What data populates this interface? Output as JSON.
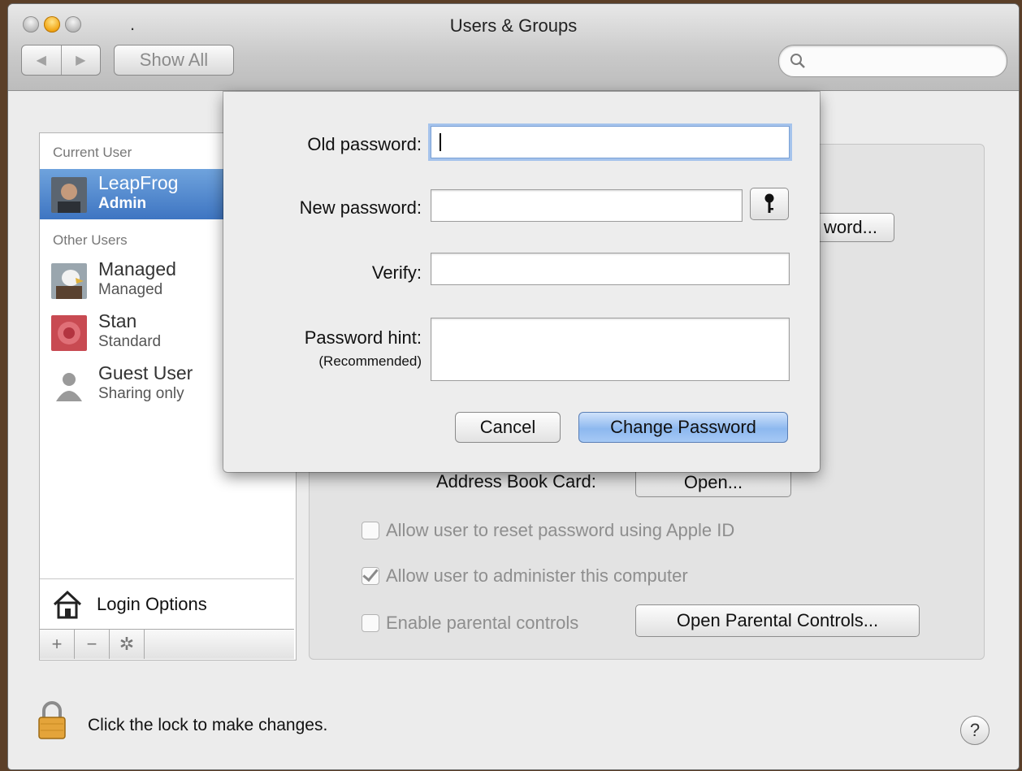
{
  "window": {
    "title": "Users & Groups",
    "title_dot": "."
  },
  "toolbar": {
    "back": "◀",
    "forward": "▶",
    "show_all": "Show All",
    "search_placeholder": ""
  },
  "sidebar": {
    "current_header": "Current User",
    "other_header": "Other Users",
    "users": [
      {
        "name": "LeapFrog",
        "role": "Admin",
        "selected": true
      },
      {
        "name": "Managed",
        "role": "Managed"
      },
      {
        "name": "Stan",
        "role": "Standard"
      },
      {
        "name": "Guest User",
        "role": "Sharing only"
      }
    ],
    "login_options": "Login Options",
    "add": "+",
    "remove": "−",
    "action": "✲"
  },
  "panel": {
    "change_password_button": "word...",
    "address_book_label": "Address Book Card:",
    "open_button": "Open...",
    "reset_apple_id": "Allow user to reset password using Apple ID",
    "administer": "Allow user to administer this computer",
    "parental": "Enable parental controls",
    "open_parental": "Open Parental Controls..."
  },
  "sheet": {
    "old_password_label": "Old password:",
    "new_password_label": "New password:",
    "verify_label": "Verify:",
    "hint_label": "Password hint:",
    "hint_sublabel": "(Recommended)",
    "cancel": "Cancel",
    "change_password": "Change Password"
  },
  "footer": {
    "lock_text": "Click the lock to make changes.",
    "help": "?"
  },
  "colors": {
    "selection": "#3e75c2",
    "primary_button": "#8db8ef",
    "focus_ring": "#a5c3ec"
  }
}
